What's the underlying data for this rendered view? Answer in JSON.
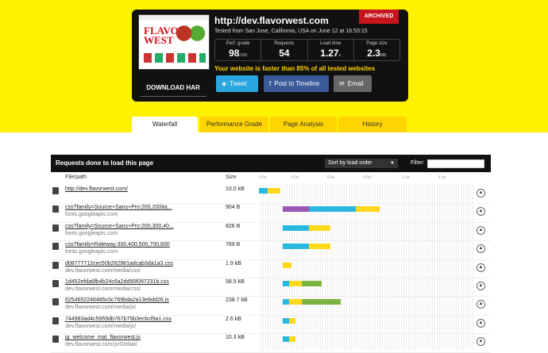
{
  "summary": {
    "url": "http://dev.flavorwest.com",
    "tested": "Tested from San Jose, California, USA on June 12 at 16:53:15",
    "archived": "ARCHIVED",
    "download_har": "DOWNLOAD HAR",
    "thumbnail_logo": "FLAVOR WEST",
    "metrics": [
      {
        "label": "Perf. grade",
        "value": "98",
        "unit": "/100"
      },
      {
        "label": "Requests",
        "value": "54",
        "unit": ""
      },
      {
        "label": "Load time",
        "value": "1.27",
        "unit": "s"
      },
      {
        "label": "Page size",
        "value": "2.3",
        "unit": "MB"
      }
    ],
    "faster_text": "Your website is faster than 85% of all tested websites",
    "share": {
      "tweet": "Tweet",
      "facebook": "Post to Timeline",
      "email": "Email"
    }
  },
  "tabs": [
    "Waterfall",
    "Performance Grade",
    "Page Analysis",
    "History"
  ],
  "panel": {
    "title": "Requests done to load this page",
    "sort_label": "Sort by load order",
    "filter_label": "Filter:",
    "columns": {
      "file": "File/path",
      "size": "Size"
    },
    "ticks": [
      "0.0s",
      "0.3s",
      "0.6s",
      "0.9s",
      "1.2s",
      "1.5s"
    ]
  },
  "requests": [
    {
      "name": "http://dev.flavorwest.com/",
      "host": "",
      "size": "10.0 kB",
      "bars": [
        [
          "#29b8e0",
          0.0,
          0.04
        ],
        [
          "#ffd91a",
          0.04,
          0.1
        ]
      ]
    },
    {
      "name": "css?family=Source+Sans+Pro:200,200ita...",
      "host": "fonts.googleapis.com",
      "size": "904 B",
      "bars": [
        [
          "#9b59b6",
          0.11,
          0.23
        ],
        [
          "#29b8e0",
          0.23,
          0.45
        ],
        [
          "#ffd91a",
          0.45,
          0.56
        ]
      ]
    },
    {
      "name": "css?family=Source+Sans+Pro:200,300,40...",
      "host": "fonts.googleapis.com",
      "size": "826 B",
      "bars": [
        [
          "#29b8e0",
          0.11,
          0.23
        ],
        [
          "#ffd91a",
          0.23,
          0.33
        ]
      ]
    },
    {
      "name": "css?family=Raleway:300,400,500,700,600",
      "host": "fonts.googleapis.com",
      "size": "789 B",
      "bars": [
        [
          "#29b8e0",
          0.11,
          0.23
        ],
        [
          "#ffd91a",
          0.23,
          0.33
        ]
      ]
    },
    {
      "name": "d08777712cec50b262981adcab3da1a3.css",
      "host": "dev.flavorwest.com/media/css/",
      "size": "1.9 kB",
      "bars": [
        [
          "#ffd91a",
          0.11,
          0.15
        ]
      ]
    },
    {
      "name": "1d452efda6fb4b24c6a2dd95f097231b.css",
      "host": "dev.flavorwest.com/media/css/",
      "size": "58.5 kB",
      "bars": [
        [
          "#29b8e0",
          0.11,
          0.14
        ],
        [
          "#ffd91a",
          0.14,
          0.2
        ],
        [
          "#7cb342",
          0.2,
          0.29
        ]
      ]
    },
    {
      "name": "6254652246485c0c769bda2a13ebdd26.js",
      "host": "dev.flavorwest.com/media/js/",
      "size": "238.7 kB",
      "bars": [
        [
          "#29b8e0",
          0.11,
          0.14
        ],
        [
          "#ffd91a",
          0.14,
          0.2
        ],
        [
          "#7cb342",
          0.2,
          0.38
        ]
      ]
    },
    {
      "name": "744983ad4c5959db767b75b3ecbcf9a1.css",
      "host": "dev.flavorwest.com/media/js/",
      "size": "2.6 kB",
      "bars": [
        [
          "#29b8e0",
          0.11,
          0.14
        ],
        [
          "#ffd91a",
          0.14,
          0.17
        ]
      ]
    },
    {
      "name": "jg_welcome_mat_flavorwest.js",
      "host": "dev.flavorwest.com/js/Global/",
      "size": "10.3 kB",
      "bars": [
        [
          "#29b8e0",
          0.11,
          0.14
        ],
        [
          "#ffd91a",
          0.14,
          0.17
        ]
      ]
    }
  ]
}
